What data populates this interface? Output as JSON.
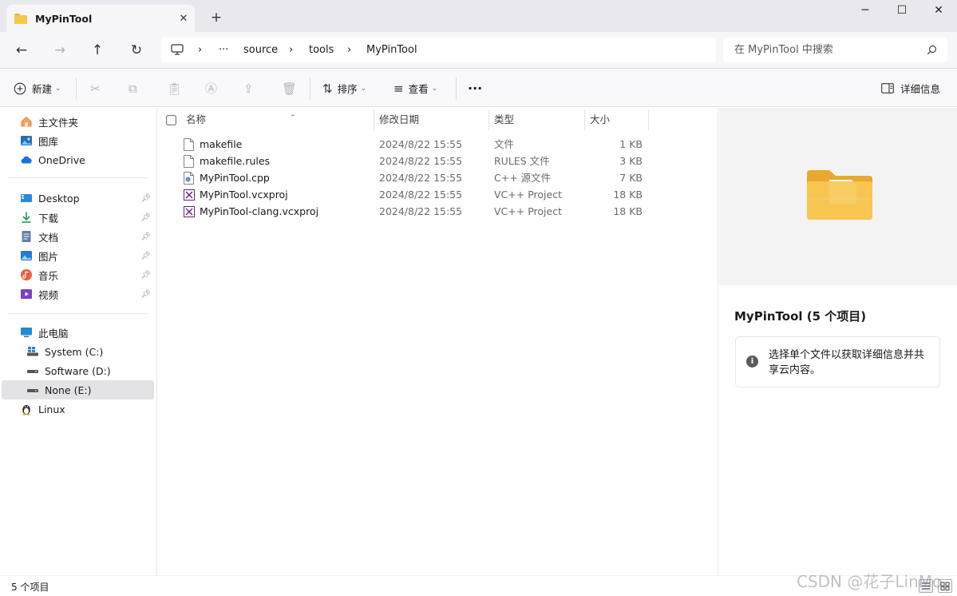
{
  "window": {
    "tab_title": "MyPinTool",
    "new_tab_glyph": "+",
    "close_tab_glyph": "✕",
    "minimize_glyph": "─",
    "maximize_glyph": "☐",
    "close_glyph": "✕"
  },
  "nav": {
    "back_glyph": "←",
    "forward_glyph": "→",
    "up_glyph": "↑",
    "refresh_glyph": "↻",
    "breadcrumb": {
      "more": "···",
      "separator": "›",
      "items": [
        "source",
        "tools",
        "MyPinTool"
      ]
    },
    "search_placeholder": "在 MyPinTool 中搜索"
  },
  "toolbar": {
    "new_label": "新建",
    "sort_label": "排序",
    "view_label": "查看",
    "more_label": "···",
    "details_label": "详细信息"
  },
  "sidebar": {
    "quick": [
      {
        "label": "主文件夹",
        "icon": "home-icon"
      },
      {
        "label": "图库",
        "icon": "gallery-icon"
      },
      {
        "label": "OneDrive",
        "icon": "cloud-icon"
      }
    ],
    "pinned": [
      {
        "label": "Desktop",
        "icon": "desktop-icon"
      },
      {
        "label": "下载",
        "icon": "download-icon"
      },
      {
        "label": "文档",
        "icon": "document-icon"
      },
      {
        "label": "图片",
        "icon": "picture-icon"
      },
      {
        "label": "音乐",
        "icon": "music-icon"
      },
      {
        "label": "视频",
        "icon": "video-icon"
      }
    ],
    "pc_label": "此电脑",
    "drives": [
      {
        "label": "System (C:)",
        "icon": "system-drive-icon"
      },
      {
        "label": "Software (D:)",
        "icon": "drive-icon"
      },
      {
        "label": "None (E:)",
        "icon": "drive-icon",
        "selected": true
      }
    ],
    "linux_label": "Linux"
  },
  "filelist": {
    "columns": {
      "name": "名称",
      "date": "修改日期",
      "type": "类型",
      "size": "大小"
    },
    "files": [
      {
        "name": "makefile",
        "date": "2024/8/22 15:55",
        "type": "文件",
        "size": "1 KB",
        "icon": "file-icon"
      },
      {
        "name": "makefile.rules",
        "date": "2024/8/22 15:55",
        "type": "RULES 文件",
        "size": "3 KB",
        "icon": "file-icon"
      },
      {
        "name": "MyPinTool.cpp",
        "date": "2024/8/22 15:55",
        "type": "C++ 源文件",
        "size": "7 KB",
        "icon": "cpp-file-icon"
      },
      {
        "name": "MyPinTool.vcxproj",
        "date": "2024/8/22 15:55",
        "type": "VC++ Project",
        "size": "18 KB",
        "icon": "vcxproj-file-icon"
      },
      {
        "name": "MyPinTool-clang.vcxproj",
        "date": "2024/8/22 15:55",
        "type": "VC++ Project",
        "size": "18 KB",
        "icon": "vcxproj-file-icon"
      }
    ]
  },
  "details": {
    "title": "MyPinTool (5 个项目)",
    "info": "选择单个文件以获取详细信息并共享云内容。"
  },
  "status": {
    "item_count": "5 个项目"
  },
  "watermark": "CSDN @花子LinMo"
}
